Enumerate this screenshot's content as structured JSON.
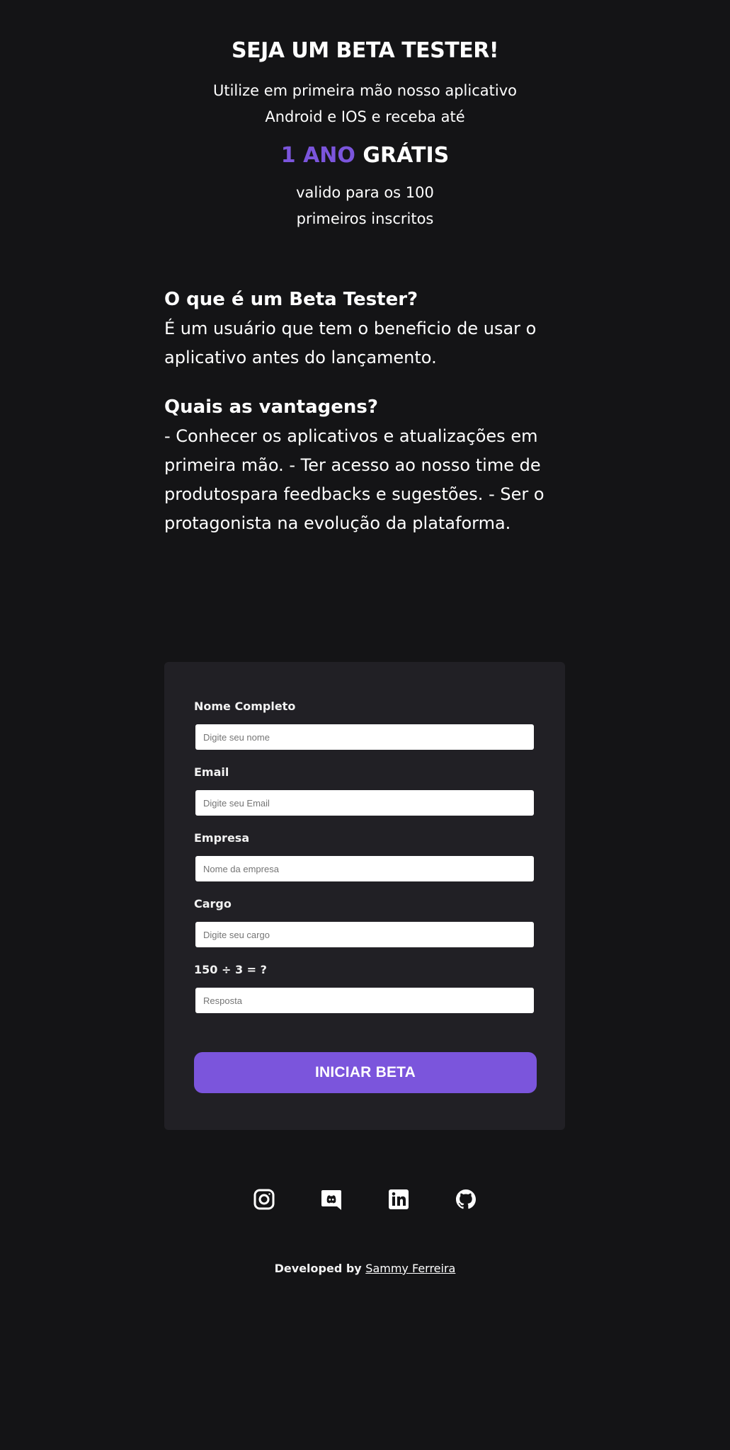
{
  "hero": {
    "title": "SEJA UM BETA TESTER!",
    "subtitle_line1": "Utilize em primeira mão nosso aplicativo",
    "subtitle_line2": "Android e IOS e receba até",
    "promo_accent": "1 ANO",
    "promo_rest": " GRÁTIS",
    "note_line1": "valido para os 100",
    "note_line2": "primeiros inscritos"
  },
  "info": {
    "what_title": "O que é um Beta Tester?",
    "what_text": "É um usuário que tem o beneficio de usar o aplicativo antes do lançamento.",
    "advantages_title": "Quais as vantagens?",
    "advantages_text": "- Conhecer os aplicativos e atualizações em primeira mão. - Ter acesso ao nosso time de produtospara feedbacks e sugestões. - Ser o protagonista na evolução da plataforma."
  },
  "form": {
    "fields": [
      {
        "label": "Nome Completo",
        "placeholder": "Digite seu nome",
        "value": ""
      },
      {
        "label": "Email",
        "placeholder": "Digite seu Email",
        "value": ""
      },
      {
        "label": "Empresa",
        "placeholder": "Nome da empresa",
        "value": ""
      },
      {
        "label": "Cargo",
        "placeholder": "Digite seu cargo",
        "value": ""
      },
      {
        "label": "150 ÷ 3 = ?",
        "placeholder": "Resposta",
        "value": ""
      }
    ],
    "submit_label": "INICIAR BETA"
  },
  "socials": {
    "icons": [
      "instagram-icon",
      "discord-icon",
      "linkedin-icon",
      "github-icon"
    ]
  },
  "footer": {
    "prefix": "Developed by ",
    "author": "Sammy Ferreira"
  },
  "colors": {
    "background": "#141416",
    "card": "#212025",
    "accent": "#7B55DC",
    "text": "#ffffff"
  }
}
